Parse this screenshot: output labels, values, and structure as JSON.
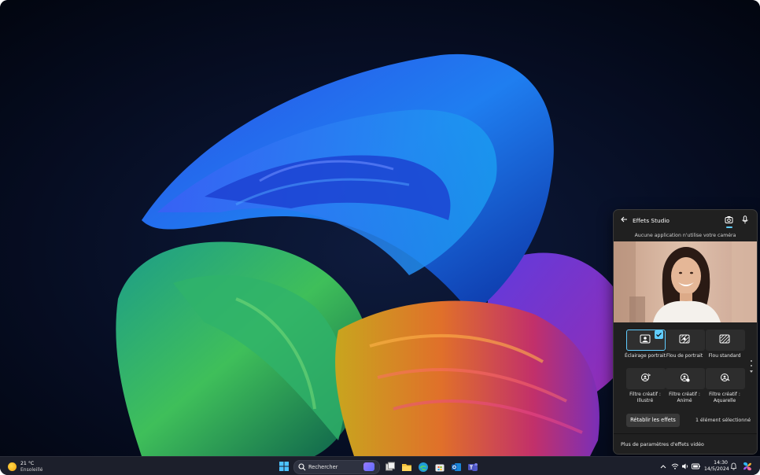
{
  "desktop": {
    "accent": "#60cdff"
  },
  "effects_panel": {
    "title": "Effets Studio",
    "status": "Aucune application n'utilise votre caméra",
    "tiles": [
      {
        "label": "Éclairage portrait",
        "icon": "portrait-light-icon",
        "selected": true
      },
      {
        "label": "Flou de portrait",
        "icon": "portrait-blur-icon",
        "selected": false
      },
      {
        "label": "Flou standard",
        "icon": "standard-blur-icon",
        "selected": false
      },
      {
        "label": "Filtre créatif : Illustré",
        "icon": "creative-filter-icon",
        "selected": false
      },
      {
        "label": "Filtre créatif : Animé",
        "icon": "creative-filter-icon",
        "selected": false
      },
      {
        "label": "Filtre créatif : Aquarelle",
        "icon": "creative-filter-icon",
        "selected": false
      }
    ],
    "reset_label": "Rétablir les effets",
    "selected_count": "1 élément sélectionné",
    "more_settings": "Plus de paramètres d'effets vidéo"
  },
  "taskbar": {
    "weather_temp": "21 °C",
    "weather_cond": "Ensoleillé",
    "search_placeholder": "Rechercher",
    "apps": [
      "task-view-icon",
      "file-explorer-icon",
      "edge-icon",
      "store-icon",
      "outlook-icon",
      "teams-icon"
    ],
    "time": "14:30",
    "date": "14/5/2024"
  }
}
